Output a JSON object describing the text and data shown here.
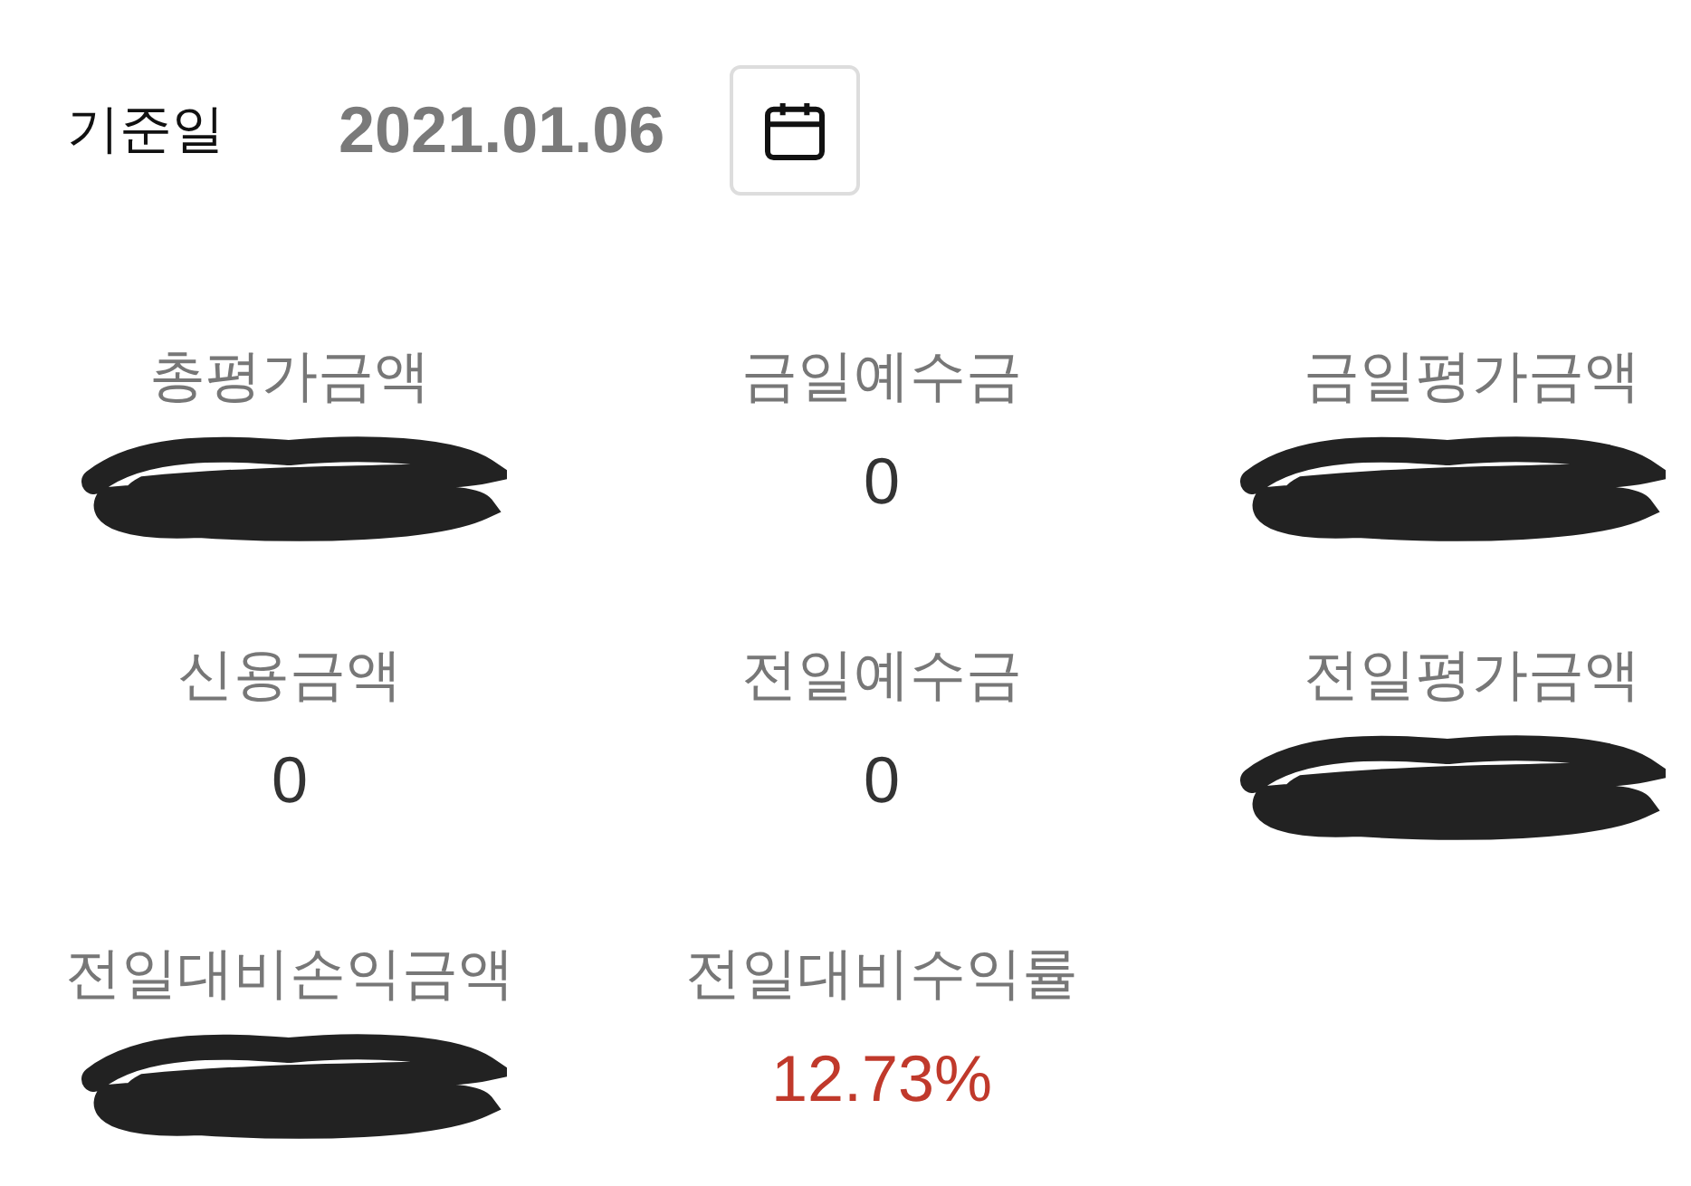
{
  "header": {
    "label": "기준일",
    "date": "2021.01.06"
  },
  "fields": [
    {
      "label": "총평가금액",
      "redacted": true
    },
    {
      "label": "금일예수금",
      "value": "0",
      "redacted": false
    },
    {
      "label": "금일평가금액",
      "redacted": true
    },
    {
      "label": "신용금액",
      "value": "0",
      "redacted": false
    },
    {
      "label": "전일예수금",
      "value": "0",
      "redacted": false
    },
    {
      "label": "전일평가금액",
      "redacted": true
    },
    {
      "label": "전일대비손익금액",
      "redacted": true
    },
    {
      "label": "전일대비수익률",
      "value": "12.73%",
      "redacted": false,
      "color": "#c0392b"
    }
  ]
}
